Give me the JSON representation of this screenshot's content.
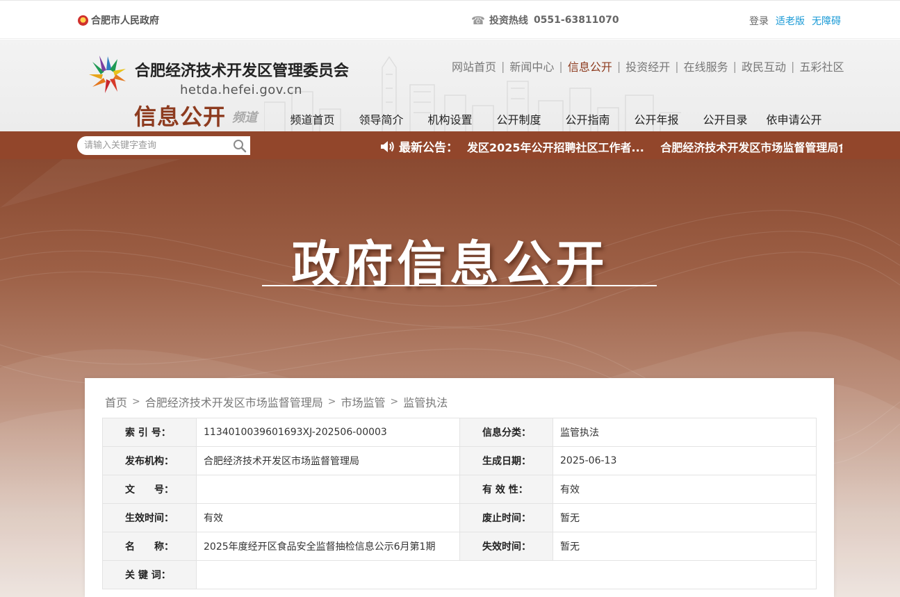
{
  "topbar": {
    "gov_name": "合肥市人民政府",
    "hotline_label": "投资热线",
    "hotline_number": "0551-63811070",
    "login": "登录",
    "elder_mode": "适老版",
    "accessible": "无障碍"
  },
  "header": {
    "org_name": "合肥经济技术开发区管理委员会",
    "domain": "hetda.hefei.gov.cn",
    "channel_title": "信息公开",
    "channel_sub": "频道",
    "top_nav": [
      {
        "label": "网站首页"
      },
      {
        "label": "新闻中心"
      },
      {
        "label": "信息公开",
        "active": true
      },
      {
        "label": "投资经开"
      },
      {
        "label": "在线服务"
      },
      {
        "label": "政民互动"
      },
      {
        "label": "五彩社区"
      }
    ],
    "sub_nav": [
      "频道首页",
      "领导简介",
      "机构设置",
      "公开制度",
      "公开指南",
      "公开年报",
      "公开目录",
      "依申请公开"
    ]
  },
  "search": {
    "placeholder": "请输入关键字查询"
  },
  "notice": {
    "label": "最新公告：",
    "items": [
      "发区2025年公开招聘社区工作者...",
      "合肥经济技术开发区市场监督管理局食品"
    ]
  },
  "banner": {
    "title": "政府信息公开"
  },
  "breadcrumb": [
    "首页",
    "合肥经济技术开发区市场监督管理局",
    "市场监管",
    "监管执法"
  ],
  "info": {
    "rows": [
      {
        "l1": "索 引 号：",
        "v1": "1134010039601693XJ-202506-00003",
        "l2": "信息分类：",
        "v2": "监管执法"
      },
      {
        "l1": "发布机构：",
        "v1": "合肥经济技术开发区市场监督管理局",
        "l2": "生成日期：",
        "v2": "2025-06-13"
      },
      {
        "l1": "文　　号：",
        "v1": "",
        "l2": "有 效 性：",
        "v2": "有效"
      },
      {
        "l1": "生效时间：",
        "v1": "有效",
        "l2": "废止时间：",
        "v2": "暂无"
      },
      {
        "l1": "名　　称：",
        "v1": "2025年度经开区食品安全监督抽检信息公示6月第1期",
        "l2": "失效时间：",
        "v2": "暂无"
      },
      {
        "l1": "关 键 词：",
        "v1": ""
      }
    ]
  },
  "colors": {
    "brand": "#92462b",
    "accent_text": "#8d3b1f",
    "link_blue": "#1a9ad6"
  }
}
